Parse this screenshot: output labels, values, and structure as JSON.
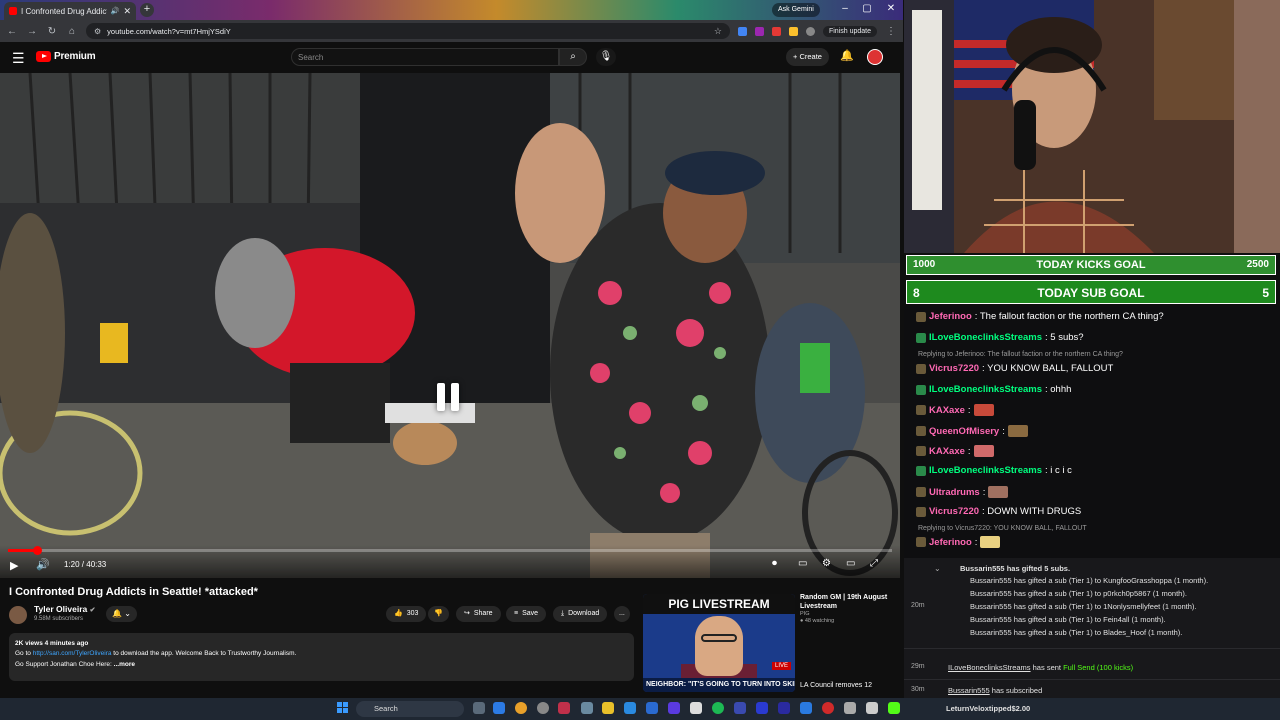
{
  "browser": {
    "tab_title": "I Confronted Drug Addicts",
    "new_tab": "+",
    "ask_gemini": "Ask Gemini",
    "url": "youtube.com/watch?v=mt7HmjYSdiY",
    "finish_update": "Finish update"
  },
  "youtube": {
    "logo_text": "Premium",
    "search_placeholder": "Search",
    "create_label": "Create"
  },
  "video": {
    "time": "1:20 / 40:33",
    "progress_fraction": 0.033,
    "title": "I Confronted Drug Addicts in Seattle! *attacked*",
    "channel": "Tyler Oliveira",
    "subs": "9.58M subscribers",
    "likes": "303",
    "share_label": "Share",
    "save_label": "Save",
    "download_label": "Download",
    "more_label": "...",
    "desc_stats": "2K views  4 minutes ago",
    "desc_line1_prefix": "Go to",
    "desc_link": "http://san.com/TylerOliveira",
    "desc_line1_suffix": "to download the app. Welcome Back to Trustworthy Journalism.",
    "desc_line2": "Go Support Jonathan Choe Here:",
    "desc_more": "...more"
  },
  "side_video": {
    "banner": "PIG LIVESTREAM",
    "live": "LIVE",
    "fox_ticker": "NEIGHBOR: \"IT'S GOING TO TURN INTO SKID ROW\"",
    "title": "Random GM | 19th August Livestream",
    "channel": "PIG",
    "watching": "48 watching",
    "next_title": "LA Council removes 12"
  },
  "goals": {
    "kicks": {
      "left": "1000",
      "label": "TODAY KICKS GOAL",
      "right": "2500"
    },
    "subs": {
      "left": "8",
      "label": "TODAY SUB GOAL",
      "right": "5"
    }
  },
  "chat": {
    "messages": [
      {
        "user": "Jeferinoo",
        "text": ": The fallout faction or the northern CA thing?",
        "color": "#ff69b4"
      },
      {
        "user": "ILoveBoneclinksStreams",
        "text": ": 5 subs?",
        "color": "#00ff7f"
      },
      {
        "reply": "Replying to Jeferinoo: The fallout faction or the northern CA thing?"
      },
      {
        "user": "Vicrus7220",
        "text": ": YOU KNOW BALL, FALLOUT",
        "color": "#ff69b4"
      },
      {
        "user": "ILoveBoneclinksStreams",
        "text": ": ohhh",
        "color": "#00ff7f"
      },
      {
        "user": "KAXaxe",
        "text": ":",
        "color": "#ff69b4"
      },
      {
        "user": "QueenOfMisery",
        "text": ":",
        "color": "#ff69b4"
      },
      {
        "user": "KAXaxe",
        "text": ":",
        "color": "#ff69b4"
      },
      {
        "user": "ILoveBoneclinksStreams",
        "text": ": i c i c",
        "color": "#00ff7f"
      },
      {
        "user": "Ultradrums",
        "text": ":",
        "color": "#ff69b4"
      },
      {
        "user": "Vicrus7220",
        "text": ": DOWN WITH DRUGS",
        "color": "#ff69b4"
      },
      {
        "reply": "Replying to Vicrus7220: YOU KNOW BALL, FALLOUT"
      },
      {
        "user": "Jeferinoo",
        "text": ":",
        "color": "#ff69b4"
      }
    ]
  },
  "events": {
    "gift_header": "Bussarin555 has gifted 5 subs.",
    "gifts": [
      "Bussarin555 has gifted a sub (Tier 1) to KungfooGrasshoppa (1 month).",
      "Bussarin555 has gifted a sub (Tier 1) to p0rkch0p5867 (1 month).",
      "Bussarin555 has gifted a sub (Tier 1) to 1Nonlysmellyfeet (1 month).",
      "Bussarin555 has gifted a sub (Tier 1) to Fein4all (1 month).",
      "Bussarin555 has gifted a sub (Tier 1) to Blades_Hoof (1 month)."
    ],
    "gift_time": "20m",
    "send_time": "29m",
    "send_user": "ILoveBoneclinksStreams",
    "send_mid": "has sent",
    "send_item": "Full Send (100 kicks)",
    "sub_time": "30m",
    "sub_user": "Bussarin555",
    "sub_text": "has subscribed",
    "last_user": "LeturnVeloxtipped",
    "last_amount": "$2.00"
  },
  "taskbar": {
    "search": "Search"
  }
}
